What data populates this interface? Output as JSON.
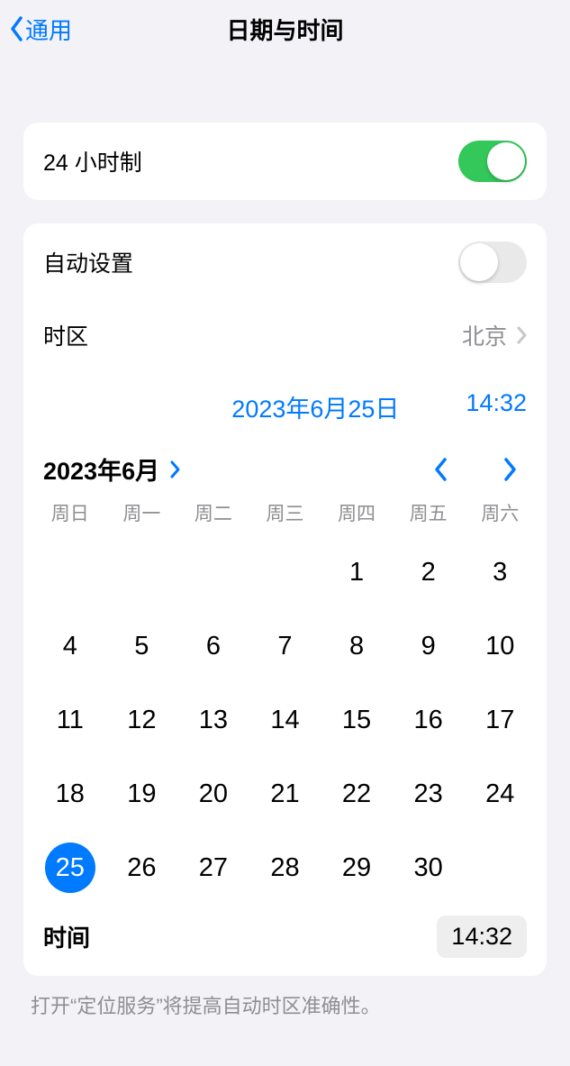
{
  "navbar": {
    "back_label": "通用",
    "title": "日期与时间"
  },
  "hour24": {
    "label": "24 小时制",
    "on": true
  },
  "auto_set": {
    "label": "自动设置",
    "on": false
  },
  "timezone": {
    "label": "时区",
    "value": "北京"
  },
  "selected": {
    "date": "2023年6月25日",
    "time": "14:32"
  },
  "calendar": {
    "month_label": "2023年6月",
    "weekdays": [
      "周日",
      "周一",
      "周二",
      "周三",
      "周四",
      "周五",
      "周六"
    ],
    "first_weekday": 4,
    "days_in_month": 30,
    "selected_day": 25
  },
  "time_section": {
    "label": "时间",
    "value": "14:32"
  },
  "footer": "打开“定位服务”将提高自动时区准确性。"
}
